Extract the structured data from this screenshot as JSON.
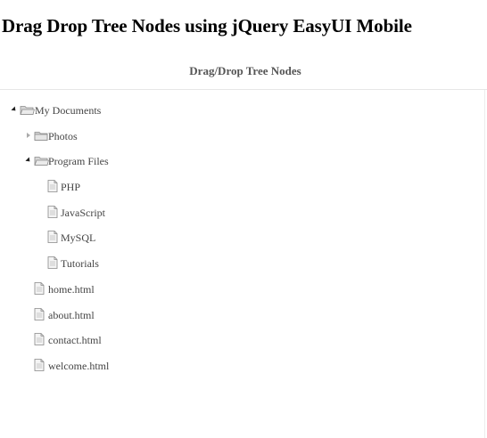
{
  "page": {
    "heading": "Drag Drop Tree Nodes using jQuery EasyUI Mobile"
  },
  "panel": {
    "title": "Drag/Drop Tree Nodes"
  },
  "tree": [
    {
      "label": "My Documents",
      "type": "folder",
      "state": "expanded"
    },
    {
      "label": "Photos",
      "type": "folder",
      "state": "collapsed"
    },
    {
      "label": "Program Files",
      "type": "folder",
      "state": "expanded"
    },
    {
      "label": "PHP",
      "type": "file"
    },
    {
      "label": "JavaScript",
      "type": "file"
    },
    {
      "label": "MySQL",
      "type": "file"
    },
    {
      "label": "Tutorials",
      "type": "file"
    },
    {
      "label": "home.html",
      "type": "file"
    },
    {
      "label": "about.html",
      "type": "file"
    },
    {
      "label": "contact.html",
      "type": "file"
    },
    {
      "label": "welcome.html",
      "type": "file"
    }
  ],
  "icons": {
    "expanded": "folder-open-icon",
    "collapsed": "folder-icon",
    "file": "file-icon",
    "expand_toggle": "chevron-down-icon",
    "collapse_toggle": "chevron-right-icon"
  },
  "colors": {
    "text": "#444444",
    "folder": "#c8c8c8",
    "border": "#e6e6e6"
  }
}
